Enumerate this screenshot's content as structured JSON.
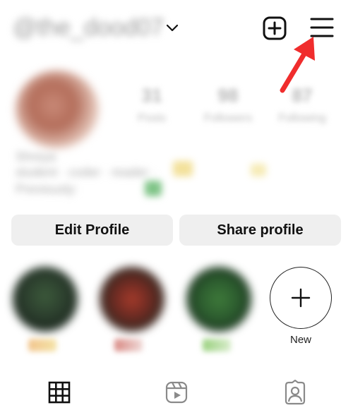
{
  "header": {
    "username": "@the_dood07",
    "chevron_icon": "chevron-down-icon",
    "create_icon": "plus-square-icon",
    "menu_icon": "hamburger-menu-icon",
    "annotation_arrow_color": "#f02d2d"
  },
  "profile": {
    "stats": [
      {
        "value": "31",
        "label": "Posts"
      },
      {
        "value": "98",
        "label": "Followers"
      },
      {
        "value": "87",
        "label": "Following"
      }
    ],
    "bio": {
      "name": "Shreya",
      "line2": "student · coder · reader ·",
      "line3": "Previously: "
    }
  },
  "buttons": {
    "edit_profile": "Edit Profile",
    "share_profile": "Share profile"
  },
  "highlights": {
    "new_label": "New"
  },
  "tabs": [
    {
      "icon": "grid-icon"
    },
    {
      "icon": "reels-icon"
    },
    {
      "icon": "tagged-icon"
    }
  ]
}
